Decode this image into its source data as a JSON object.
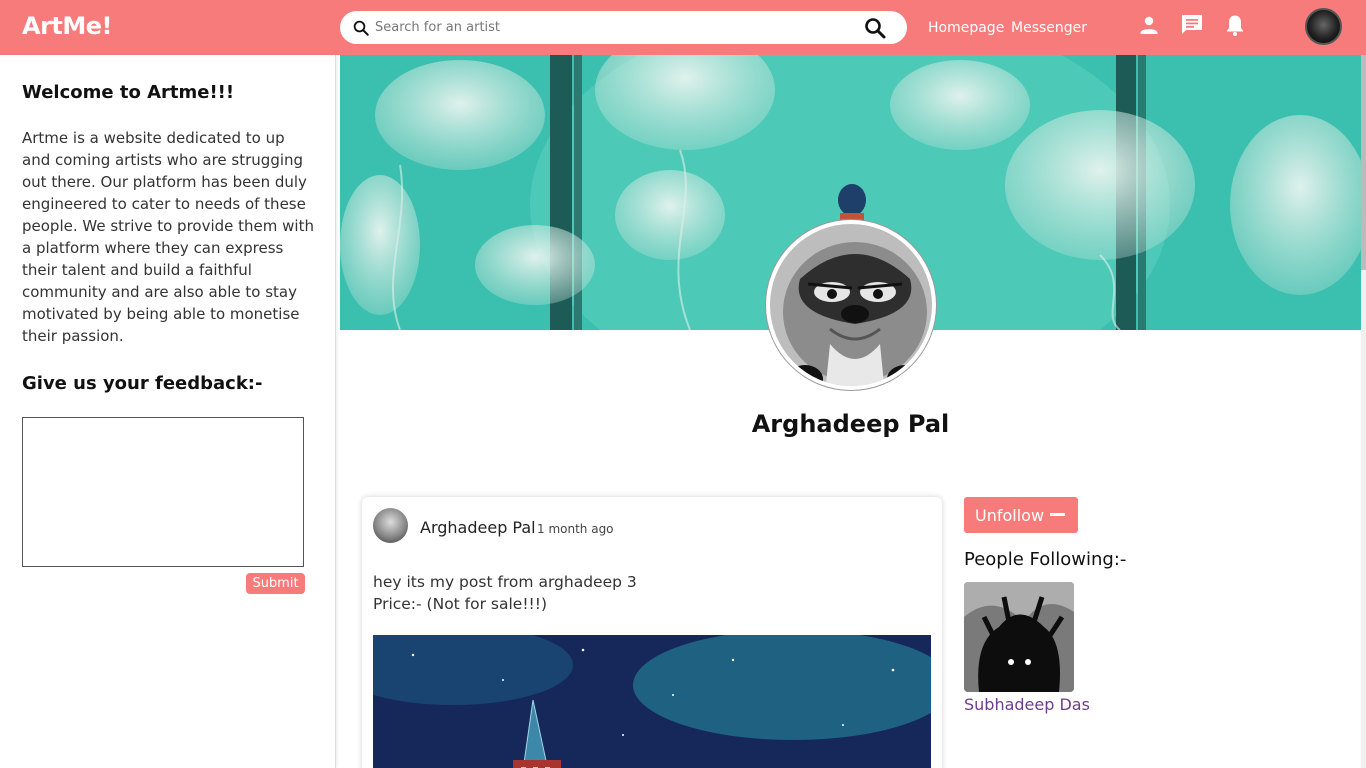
{
  "header": {
    "brand": "ArtMe!",
    "search_placeholder": "Search for an artist",
    "nav": {
      "homepage": "Homepage",
      "messenger": "Messenger"
    },
    "icons": [
      "person-icon",
      "chat-icon",
      "bell-icon"
    ]
  },
  "sidebar": {
    "welcome": "Welcome to Artme!!!",
    "about": "Artme is a website dedicated to up and coming artists who are strugging out there. Our platform has been duly engineered to cater to needs of these people. We strive to provide them with a platform where they can express their talent and build a faithful community and are also able to stay motivated by being able to monetise their passion.",
    "feedback_title": "Give us your feedback:-",
    "submit_label": "Submit"
  },
  "profile": {
    "name": "Arghadeep Pal"
  },
  "post": {
    "author": "Arghadeep Pal",
    "time": "1 month ago",
    "text": "hey its my post from arghadeep 3",
    "price": "Price:- (Not for sale!!!)"
  },
  "following": {
    "unfollow_label": "Unfollow",
    "title": "People Following:-",
    "people": [
      {
        "name": "Subhadeep Das"
      }
    ]
  },
  "colors": {
    "accent": "#f77b7b",
    "link": "#6d3d8d"
  }
}
